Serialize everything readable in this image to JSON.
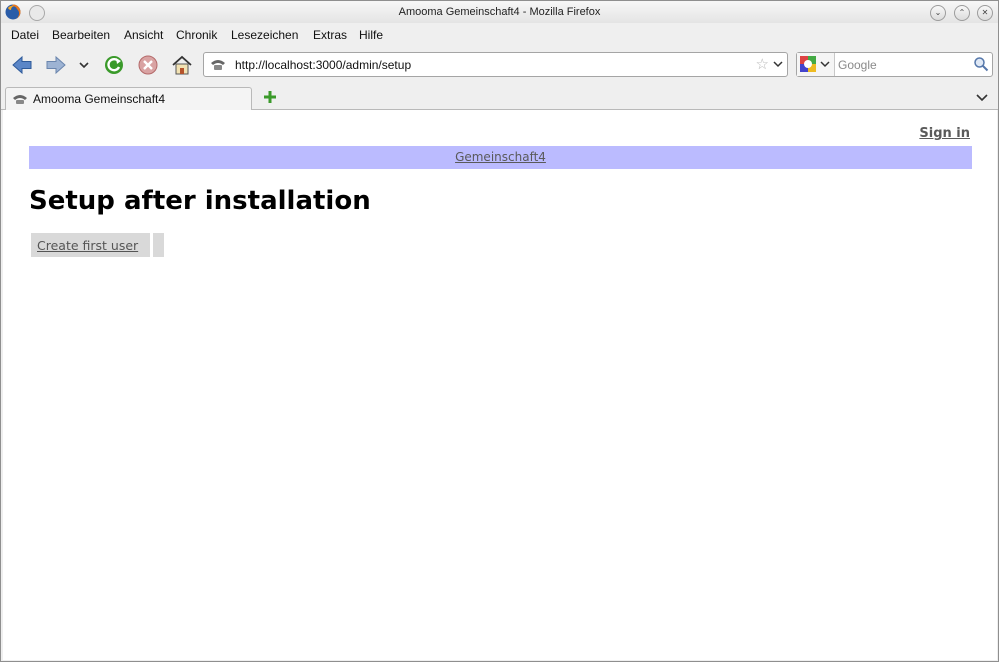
{
  "window": {
    "title": "Amooma Gemeinschaft4 - Mozilla Firefox"
  },
  "menubar": {
    "items": [
      "Datei",
      "Bearbeiten",
      "Ansicht",
      "Chronik",
      "Lesezeichen",
      "Extras",
      "Hilfe"
    ]
  },
  "navbar": {
    "icons": [
      "back-icon",
      "forward-icon",
      "history-dropdown-icon",
      "reload-icon",
      "stop-icon",
      "home-icon"
    ]
  },
  "urlbar": {
    "url": "http://localhost:3000/admin/setup"
  },
  "search": {
    "placeholder": "Google"
  },
  "tabs": [
    {
      "label": "Amooma Gemeinschaft4",
      "active": true
    }
  ],
  "page": {
    "signin_label": "Sign in",
    "brand_link": "Gemeinschaft4",
    "heading": "Setup after installation",
    "action_label": "Create first user"
  },
  "colors": {
    "brand_bar": "#bbbbff",
    "button_bg": "#d9d9d9",
    "link_gray": "#5a5a5a"
  }
}
